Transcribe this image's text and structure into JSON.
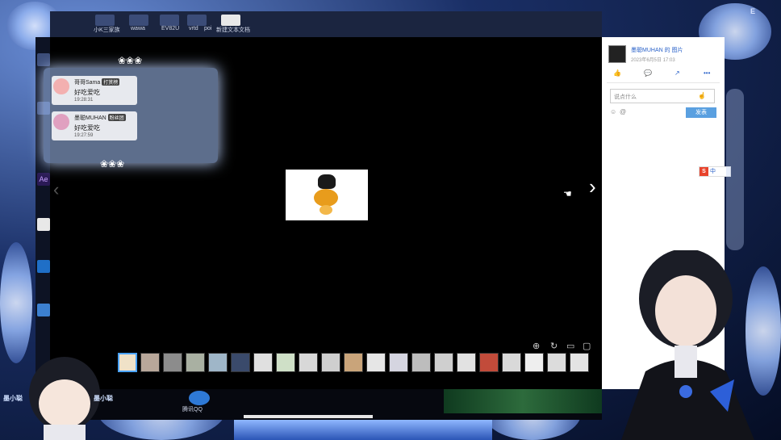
{
  "desktop": {
    "icons": [
      {
        "label": "小K三家族",
        "icon": "app-icon"
      },
      {
        "label": "wawa",
        "icon": "app-icon"
      },
      {
        "label": "EV82U",
        "icon": "app-icon"
      },
      {
        "label": "vrtd",
        "icon": "app-icon"
      },
      {
        "label": "poi",
        "icon": "app-icon"
      },
      {
        "label": "新建文本文档",
        "icon": "text-file-icon"
      }
    ],
    "taskbar_label": "腾讯QQ",
    "left_tiles": [
      "Ae",
      "Ps"
    ]
  },
  "viewer": {
    "prev_glyph": "‹",
    "next_glyph": "›",
    "tools": [
      "⊕",
      "↻",
      "▭",
      "▢"
    ],
    "thumbnail_count": 19,
    "selected_thumbnail": 0
  },
  "sidebar": {
    "poster_name": "墨聪MUHAN 的 图片",
    "post_time": "2023年6月5日  17:03",
    "actions": [
      "👍",
      "💬",
      "↗",
      "•••"
    ],
    "comment_placeholder": "说点什么",
    "emoji_icons": [
      "☺",
      "@"
    ],
    "submit_label": "发表"
  },
  "ime": {
    "logo": "S",
    "mode": "中"
  },
  "chat": {
    "messages": [
      {
        "user": "哥哥Sama",
        "badge": "打赏榜",
        "text": "好吃爱吃",
        "time": "19:28:31"
      },
      {
        "user": "墨聪MUHAN",
        "badge": "粉丝团",
        "text": "好吃爱吃",
        "time": "19:27:59"
      }
    ]
  },
  "overlay": {
    "brand": "E",
    "tags": [
      "墨小聪",
      "墨小聪"
    ]
  },
  "colors": {
    "accent": "#2a62c9",
    "submit": "#5aa0e0",
    "selected_thumb": "#4aa3ff"
  }
}
